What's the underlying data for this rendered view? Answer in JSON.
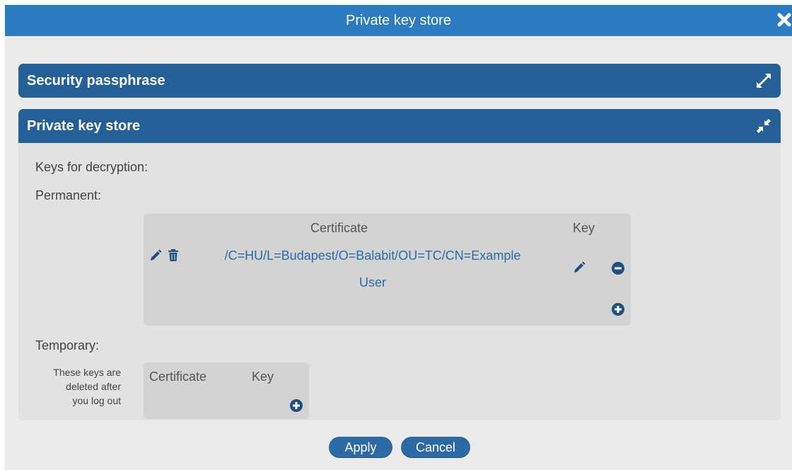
{
  "window": {
    "title": "Private key store",
    "close_icon": "close-x-icon"
  },
  "panels": {
    "security": {
      "title": "Security passphrase",
      "state": "collapsed",
      "toggle_icon": "expand-icon"
    },
    "keystore": {
      "title": "Private key store",
      "state": "expanded",
      "toggle_icon": "collapse-icon",
      "keys_label": "Keys for decryption:",
      "permanent": {
        "label": "Permanent:",
        "columns": [
          "Certificate",
          "Key"
        ],
        "rows": [
          {
            "certificate_line1": "/C=HU/L=Budapest/O=Balabit/OU=TC/CN=Example",
            "certificate_line2": "User"
          }
        ]
      },
      "temporary": {
        "label": "Temporary:",
        "note_lines": [
          "These keys are",
          "deleted after",
          "you log out"
        ],
        "columns": [
          "Certificate",
          "Key"
        ]
      }
    }
  },
  "footer": {
    "apply_label": "Apply",
    "cancel_label": "Cancel"
  },
  "colors": {
    "titlebar": "#2d7cc0",
    "panel_header": "#245f96",
    "link": "#2a6cab",
    "button": "#2d6aa3"
  }
}
